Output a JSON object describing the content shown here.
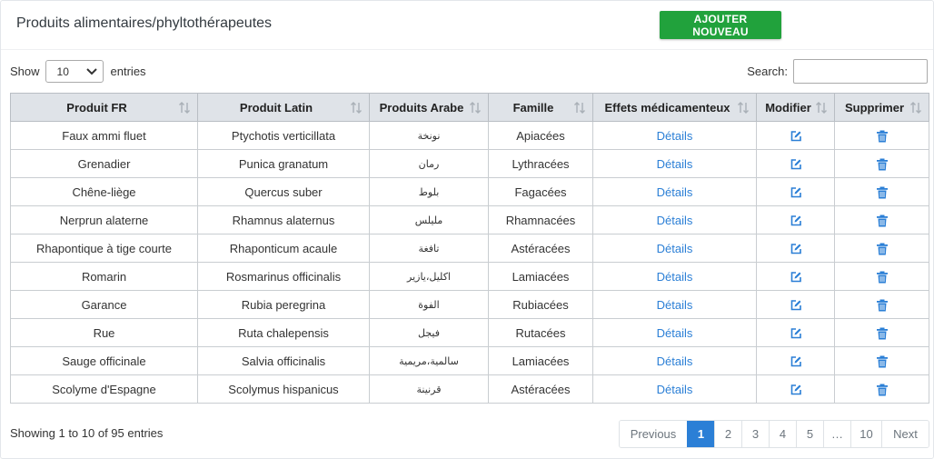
{
  "header": {
    "title": "Produits alimentaires/phyltothérapeutes",
    "add_button": "AJOUTER NOUVEAU"
  },
  "length_menu": {
    "show_label": "Show",
    "selected": "10",
    "entries_label": "entries"
  },
  "search": {
    "label": "Search:",
    "value": ""
  },
  "table": {
    "columns": [
      "Produit FR",
      "Produit Latin",
      "Produits Arabe",
      "Famille",
      "Effets médicamenteux",
      "Modifier",
      "Supprimer"
    ],
    "link_text": "Détails",
    "rows": [
      [
        "Faux ammi fluet",
        "Ptychotis verticillata",
        "نونخة",
        "Apiacées"
      ],
      [
        "Grenadier",
        "Punica granatum",
        "رمان",
        "Lythracées"
      ],
      [
        "Chêne-liège",
        "Quercus suber",
        "بلوط",
        "Fagacées"
      ],
      [
        "Nerprun alaterne",
        "Rhamnus alaternus",
        "مليلس",
        "Rhamnacées"
      ],
      [
        "Rhapontique à tige courte",
        "Rhaponticum acaule",
        "تافغة",
        "Astéracées"
      ],
      [
        "Romarin",
        "Rosmarinus officinalis",
        "اكليل،يازير",
        "Lamiacées"
      ],
      [
        "Garance",
        "Rubia peregrina",
        "الفوة",
        "Rubiacées"
      ],
      [
        "Rue",
        "Ruta chalepensis",
        "فيجل",
        "Rutacées"
      ],
      [
        "Sauge officinale",
        "Salvia officinalis",
        "سالمية،مريمية",
        "Lamiacées"
      ],
      [
        "Scolyme d'Espagne",
        "Scolymus hispanicus",
        "قرنينة",
        "Astéracées"
      ]
    ]
  },
  "footer": {
    "info": "Showing 1 to 10 of 95 entries",
    "pagination": [
      "Previous",
      "1",
      "2",
      "3",
      "4",
      "5",
      "…",
      "10",
      "Next"
    ],
    "active_page": "1"
  },
  "colors": {
    "accent": "#2b7fd6",
    "add_button": "#21a23c",
    "header_bg": "#dfe3e8"
  },
  "icons": {
    "edit": "edit-icon",
    "delete": "trash-icon",
    "sort": "sort-icon",
    "dropdown": "chevron-down-icon"
  }
}
